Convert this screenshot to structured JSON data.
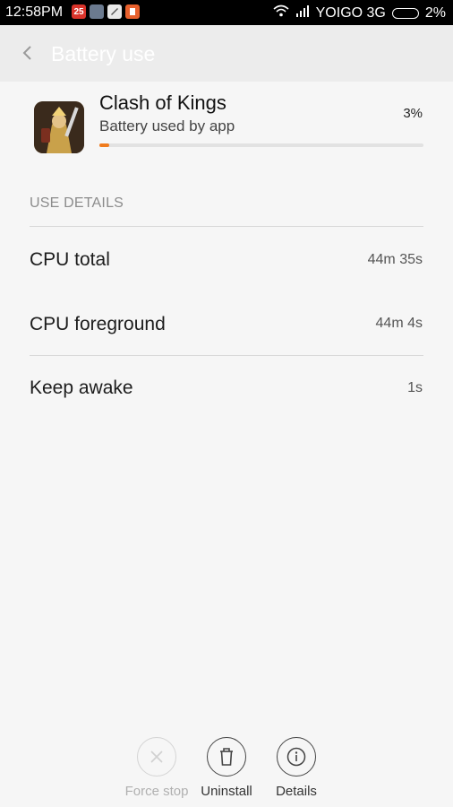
{
  "status_bar": {
    "time": "12:58PM",
    "notifications": [
      "25",
      "",
      "",
      ""
    ],
    "carrier": "YOIGO 3G",
    "battery": "2%"
  },
  "header": {
    "title": "Battery use"
  },
  "app": {
    "name": "Clash of Kings",
    "subtitle": "Battery used by app",
    "percent": "3%",
    "usage_fraction": 0.03
  },
  "details": {
    "section_label": "USE DETAILS",
    "rows": [
      {
        "label": "CPU total",
        "value": "44m 35s"
      },
      {
        "label": "CPU foreground",
        "value": "44m 4s"
      },
      {
        "label": "Keep awake",
        "value": "1s"
      }
    ]
  },
  "actions": {
    "force_stop": "Force stop",
    "uninstall": "Uninstall",
    "details": "Details"
  },
  "colors": {
    "accent": "#f07b1d",
    "header_bg": "#ececec",
    "page_bg": "#f6f6f6"
  }
}
